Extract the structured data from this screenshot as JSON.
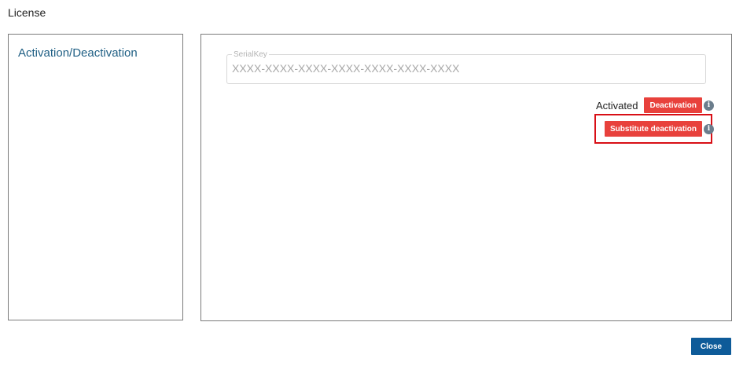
{
  "dialog": {
    "title": "License",
    "close_label": "Close"
  },
  "nav": {
    "items": [
      {
        "label": "Activation/Deactivation"
      }
    ]
  },
  "serial_key": {
    "label": "SerialKey",
    "placeholder": "XXXX-XXXX-XXXX-XXXX-XXXX-XXXX-XXXX",
    "value": ""
  },
  "status": {
    "text": "Activated",
    "deactivation_label": "Deactivation",
    "substitute_deactivation_label": "Substitute deactivation",
    "info_glyph": "i"
  },
  "colors": {
    "accent_red": "#e8413c",
    "highlight_border": "#d80f16",
    "nav_text": "#1f5f84",
    "primary_button": "#0e5b99",
    "info_icon": "#6b7d8c"
  }
}
